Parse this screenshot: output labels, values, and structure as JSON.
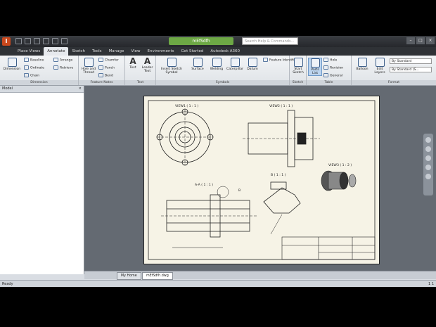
{
  "title_bar": {
    "doc_title": "mEfSdfh",
    "search_placeholder": "Search Help & Commands..."
  },
  "tabs": [
    "Place Views",
    "Annotate",
    "Sketch",
    "Tools",
    "Manage",
    "View",
    "Environments",
    "Get Started",
    "Autodesk A360"
  ],
  "ribbon": {
    "dimension": {
      "big_label": "Dimension",
      "items": [
        "Baseline",
        "Ordinate",
        "Chain",
        "Arrange",
        "Retrieve"
      ],
      "title": "Dimension"
    },
    "feature_notes": {
      "big_label": "Hole and Thread",
      "items": [
        "Chamfer",
        "Punch",
        "Bend"
      ],
      "title": "Feature Notes"
    },
    "text": {
      "items": [
        "Text",
        "Leader Text"
      ],
      "title": "Text"
    },
    "symbols": {
      "items": [
        "Insert Sketch Symbol",
        "Surface",
        "Welding",
        "Caterpillar",
        "Datum",
        "Feature Identifier"
      ],
      "title": "Symbols"
    },
    "sketch": {
      "item": "Start Sketch",
      "title": "Sketch"
    },
    "table": {
      "items": [
        "Parts List",
        "Hole",
        "Revision",
        "General"
      ],
      "title": "Table"
    },
    "format": {
      "items": [
        "Balloon",
        "Edit Layers",
        "By Standard",
        "By Standard (S..."
      ],
      "title": "Format"
    }
  },
  "browser": {
    "header": "Model",
    "close": "×"
  },
  "drawing": {
    "views": [
      "VIEW1 ( 1 : 1 )",
      "VIEW2 ( 1 : 1 )",
      "A-A ( 1 : 1 )",
      "B ( 1 : 1 )",
      "VIEW3 ( 1 : 2 )"
    ],
    "section_letter": "B"
  },
  "doc_tabs": [
    "My Home",
    "mEfSdfh.dwg"
  ],
  "status": {
    "left": "Ready",
    "right": "1  1"
  }
}
